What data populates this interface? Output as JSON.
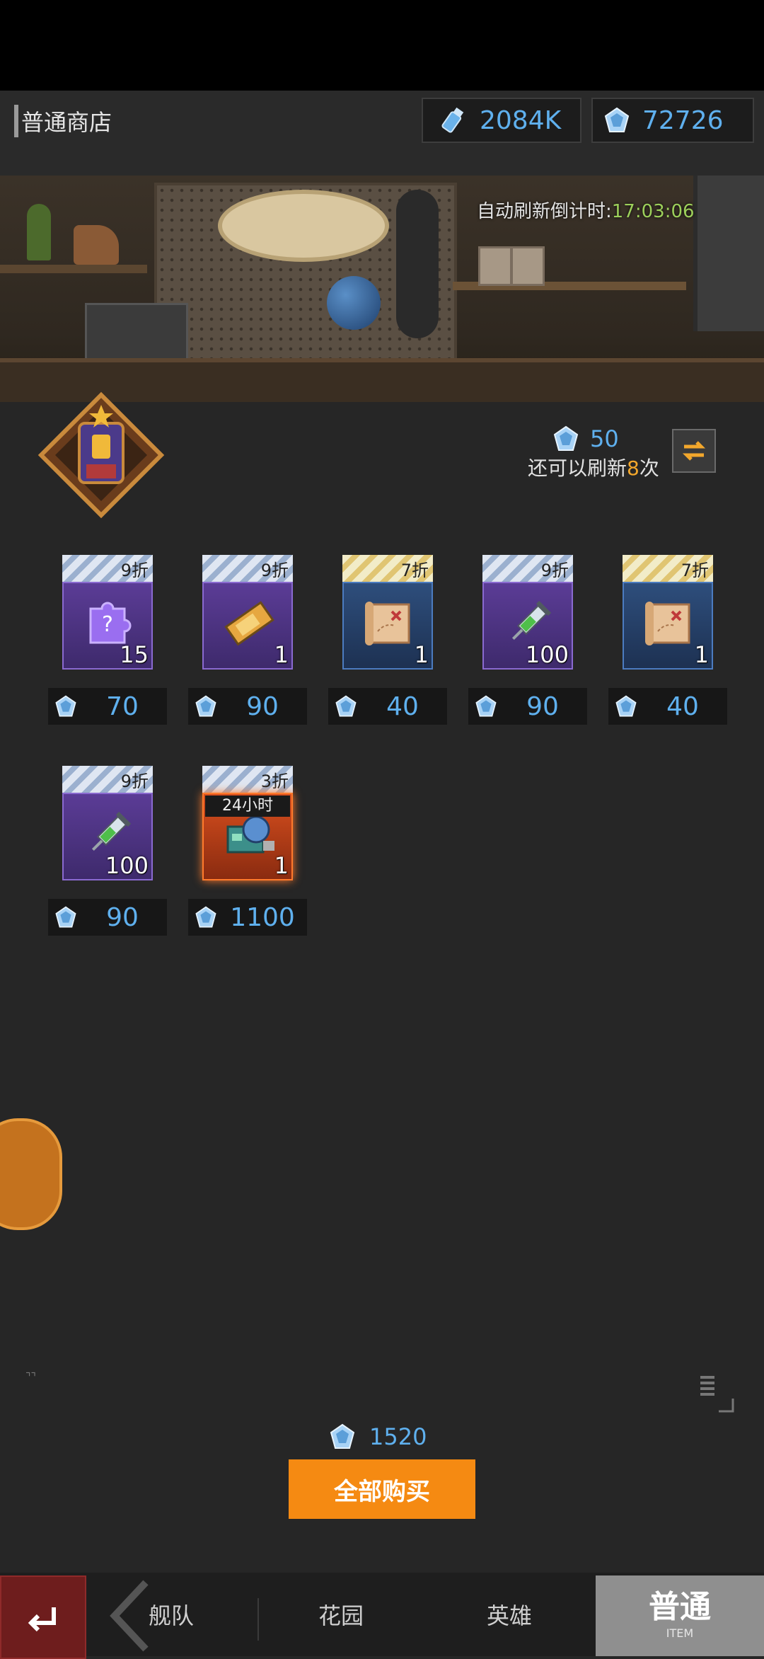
{
  "header": {
    "shop_title": "普通商店",
    "currency_1": "2084K",
    "currency_2": "72726"
  },
  "banner": {
    "auto_refresh_label": "自动刷新倒计时:",
    "auto_refresh_time": "17:03:06"
  },
  "refresh": {
    "cost": "50",
    "remaining_prefix": "还可以刷新",
    "remaining_count": "8",
    "remaining_suffix": "次"
  },
  "items": [
    {
      "discount": "9折",
      "qty": "15",
      "price": "70",
      "icon": "mystery-puzzle-icon"
    },
    {
      "discount": "9折",
      "qty": "1",
      "price": "90",
      "icon": "ticket-icon"
    },
    {
      "discount": "7折",
      "qty": "1",
      "price": "40",
      "icon": "treasure-map-icon"
    },
    {
      "discount": "9折",
      "qty": "100",
      "price": "90",
      "icon": "syringe-icon"
    },
    {
      "discount": "7折",
      "qty": "1",
      "price": "40",
      "icon": "treasure-map-icon"
    },
    {
      "discount": "9折",
      "qty": "100",
      "price": "90",
      "icon": "syringe-icon"
    },
    {
      "discount": "3折",
      "qty": "1",
      "price": "1100",
      "icon": "machine-icon",
      "timer": "24小时"
    }
  ],
  "footer": {
    "total": "1520",
    "buy_all": "全部购买"
  },
  "nav": {
    "tab_fleet": "舰队",
    "tab_garden": "花园",
    "tab_hero": "英雄",
    "tab_normal": "普通",
    "tab_normal_sub": "ITEM"
  },
  "colors": {
    "accent_blue": "#5fb0ee",
    "buy_orange": "#f58a12",
    "timer_green": "#9ccf5a",
    "count_orange": "#f2a72c"
  }
}
